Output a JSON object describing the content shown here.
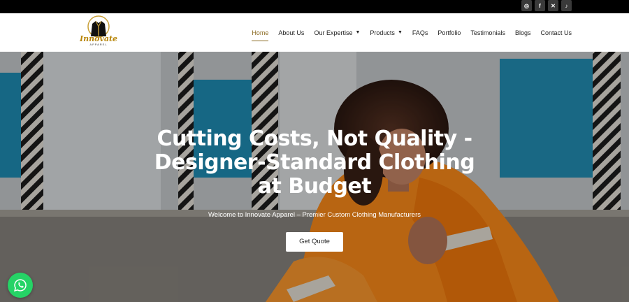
{
  "social": [
    {
      "icon": "instagram-icon",
      "glyph": "◎"
    },
    {
      "icon": "facebook-icon",
      "glyph": "f"
    },
    {
      "icon": "x-twitter-icon",
      "glyph": "✕"
    },
    {
      "icon": "tiktok-icon",
      "glyph": "♪"
    }
  ],
  "logo": {
    "word": "Innovate",
    "sub": "APPAREL"
  },
  "nav": {
    "home": "Home",
    "about": "About Us",
    "expertise": "Our Expertise",
    "products": "Products",
    "faqs": "FAQs",
    "portfolio": "Portfolio",
    "testimonials": "Testimonials",
    "blogs": "Blogs",
    "contact": "Contact Us"
  },
  "hero": {
    "title": "Cutting Costs, Not Quality - Designer-Standard Clothing at Budget",
    "subtitle": "Welcome to Innovate Apparel – Premier Custom Clothing Manufacturers",
    "cta": "Get Quote"
  },
  "colors": {
    "accent": "#8b6a22",
    "whatsapp": "#25d366",
    "topbar": "#000000"
  }
}
